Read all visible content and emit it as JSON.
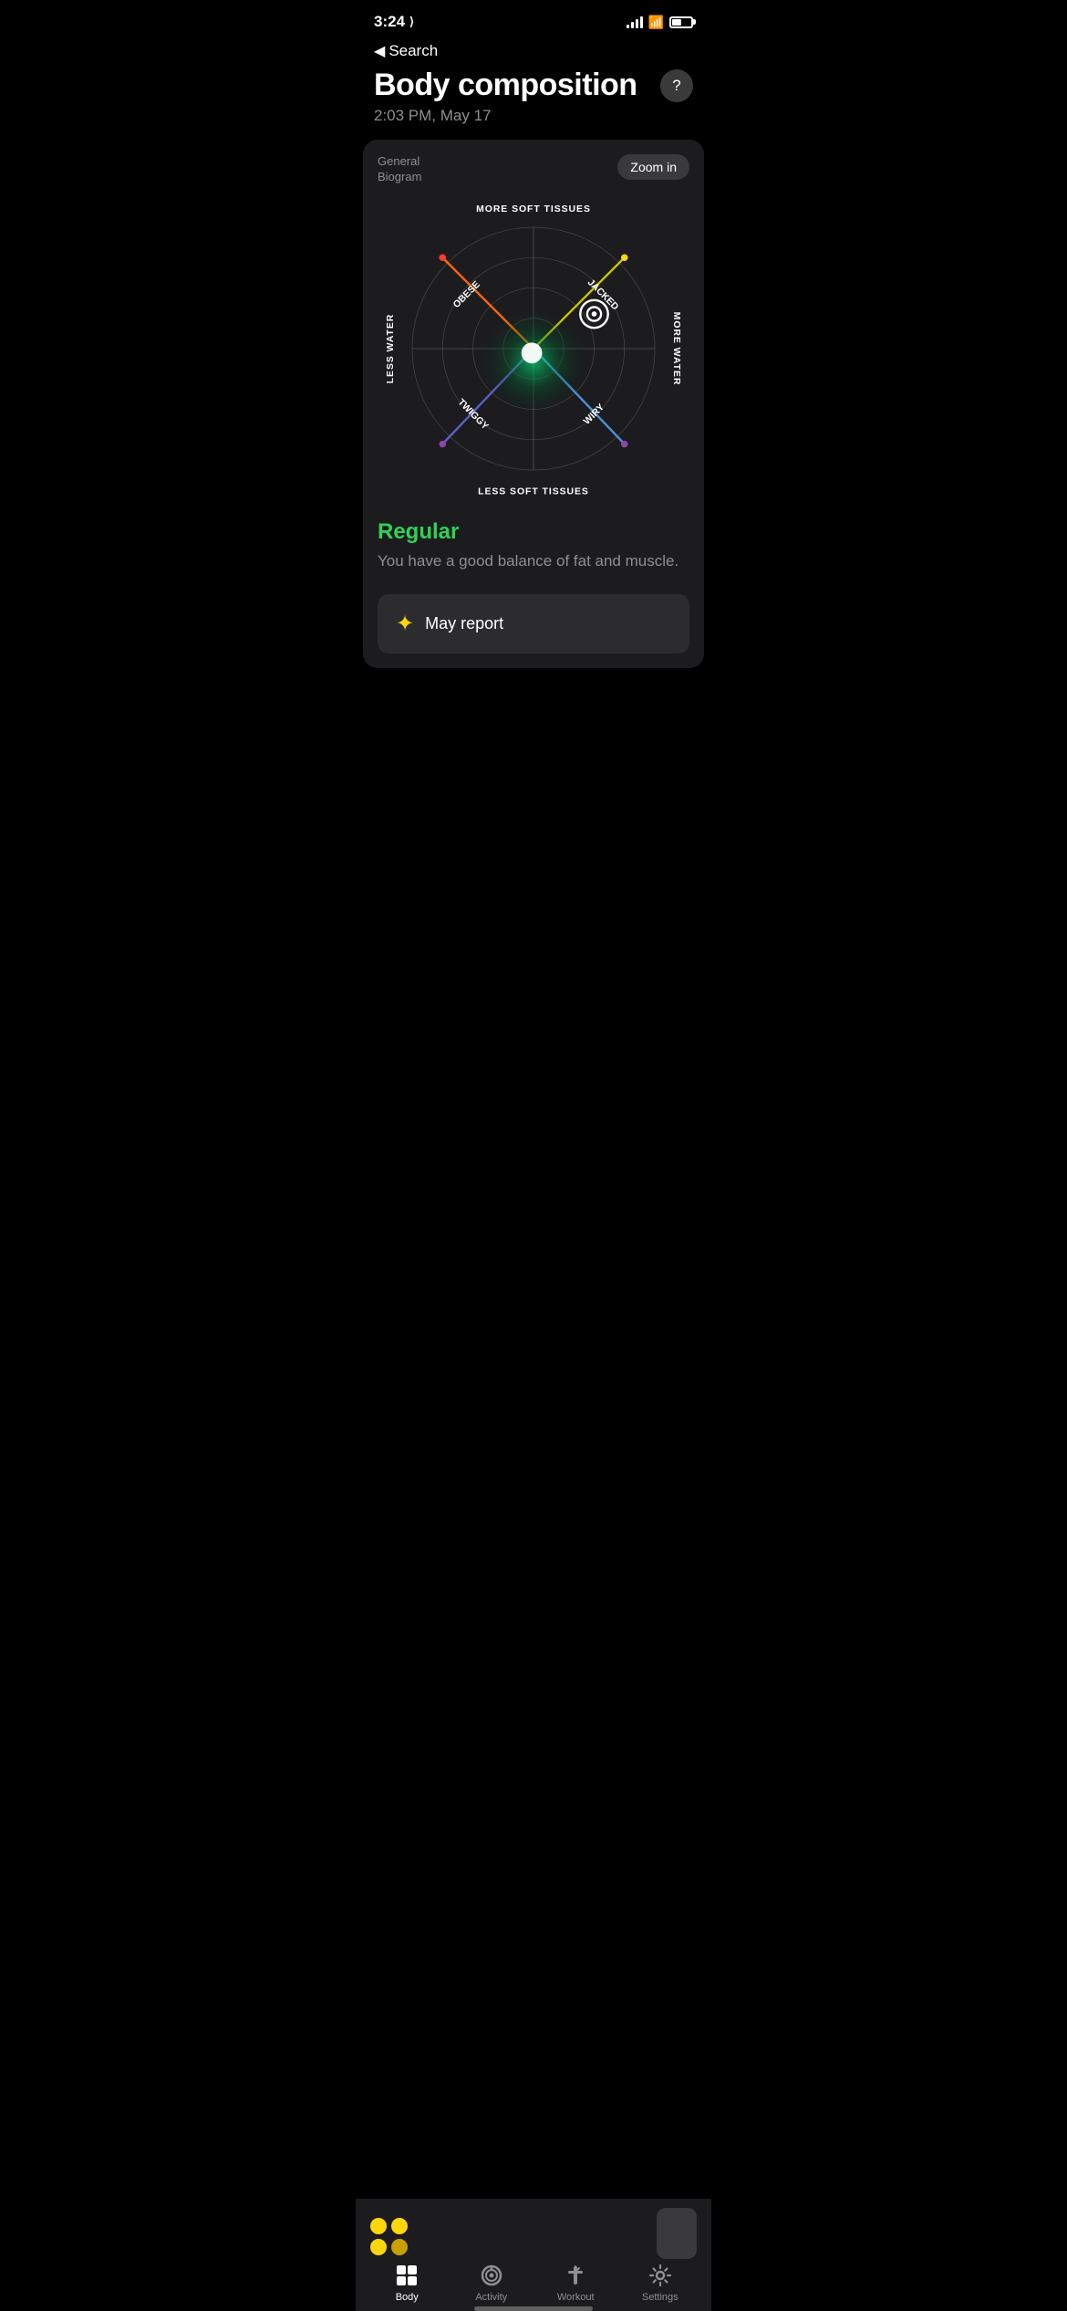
{
  "statusBar": {
    "time": "3:24",
    "locationIcon": "▶",
    "batteryPercent": 50
  },
  "header": {
    "backLabel": "Search",
    "title": "Body composition",
    "subtitle": "2:03 PM, May 17",
    "helpButtonLabel": "?"
  },
  "biogram": {
    "label": "General\nBiogram",
    "zoomButtonLabel": "Zoom in",
    "labels": {
      "top": "MORE SOFT TISSUES",
      "bottom": "LESS SOFT TISSUES",
      "left": "LESS WATER",
      "right": "MORE WATER",
      "topLeft": "OBESE",
      "topRight": "JACKED",
      "bottomLeft": "TWIGGY",
      "bottomRight": "WIRY"
    }
  },
  "result": {
    "title": "Regular",
    "description": "You have a good balance of fat and muscle."
  },
  "reportButton": {
    "label": "May report",
    "sparkleIcon": "✦"
  },
  "bottomNav": {
    "items": [
      {
        "id": "body",
        "label": "Body",
        "active": true
      },
      {
        "id": "activity",
        "label": "Activity",
        "active": false
      },
      {
        "id": "workout",
        "label": "Workout",
        "active": false
      },
      {
        "id": "settings",
        "label": "Settings",
        "active": false
      }
    ]
  }
}
